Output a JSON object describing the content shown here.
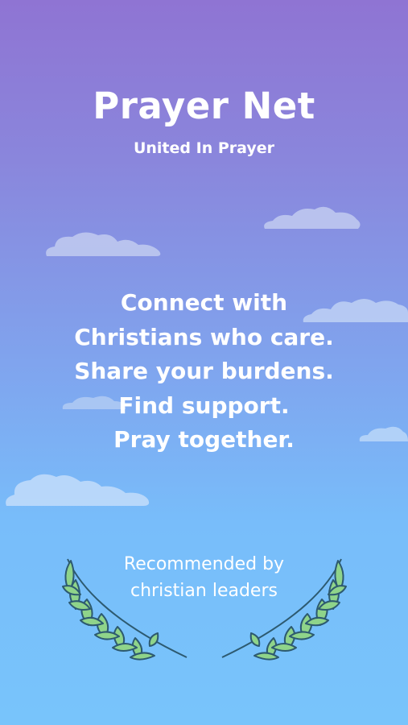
{
  "app": {
    "title": "Prayer Net",
    "subtitle": "United In Prayer"
  },
  "tagline": {
    "lines": [
      "Connect with",
      "Christians who care.",
      "Share your burdens.",
      "Find support.",
      "Pray together."
    ]
  },
  "recommendation": {
    "lines": [
      "Recommended by",
      "christian leaders"
    ]
  },
  "colors": {
    "gradient_top": "#8f74d3",
    "gradient_bottom": "#78c4fb",
    "text": "#ffffff",
    "cloud": "#c9d9f6",
    "laurel_leaf": "#8fd48a",
    "laurel_outline": "#2d5a70"
  },
  "icons": {
    "left_decoration": "laurel-branch-icon",
    "right_decoration": "laurel-branch-icon",
    "background": "cloud-icon"
  }
}
